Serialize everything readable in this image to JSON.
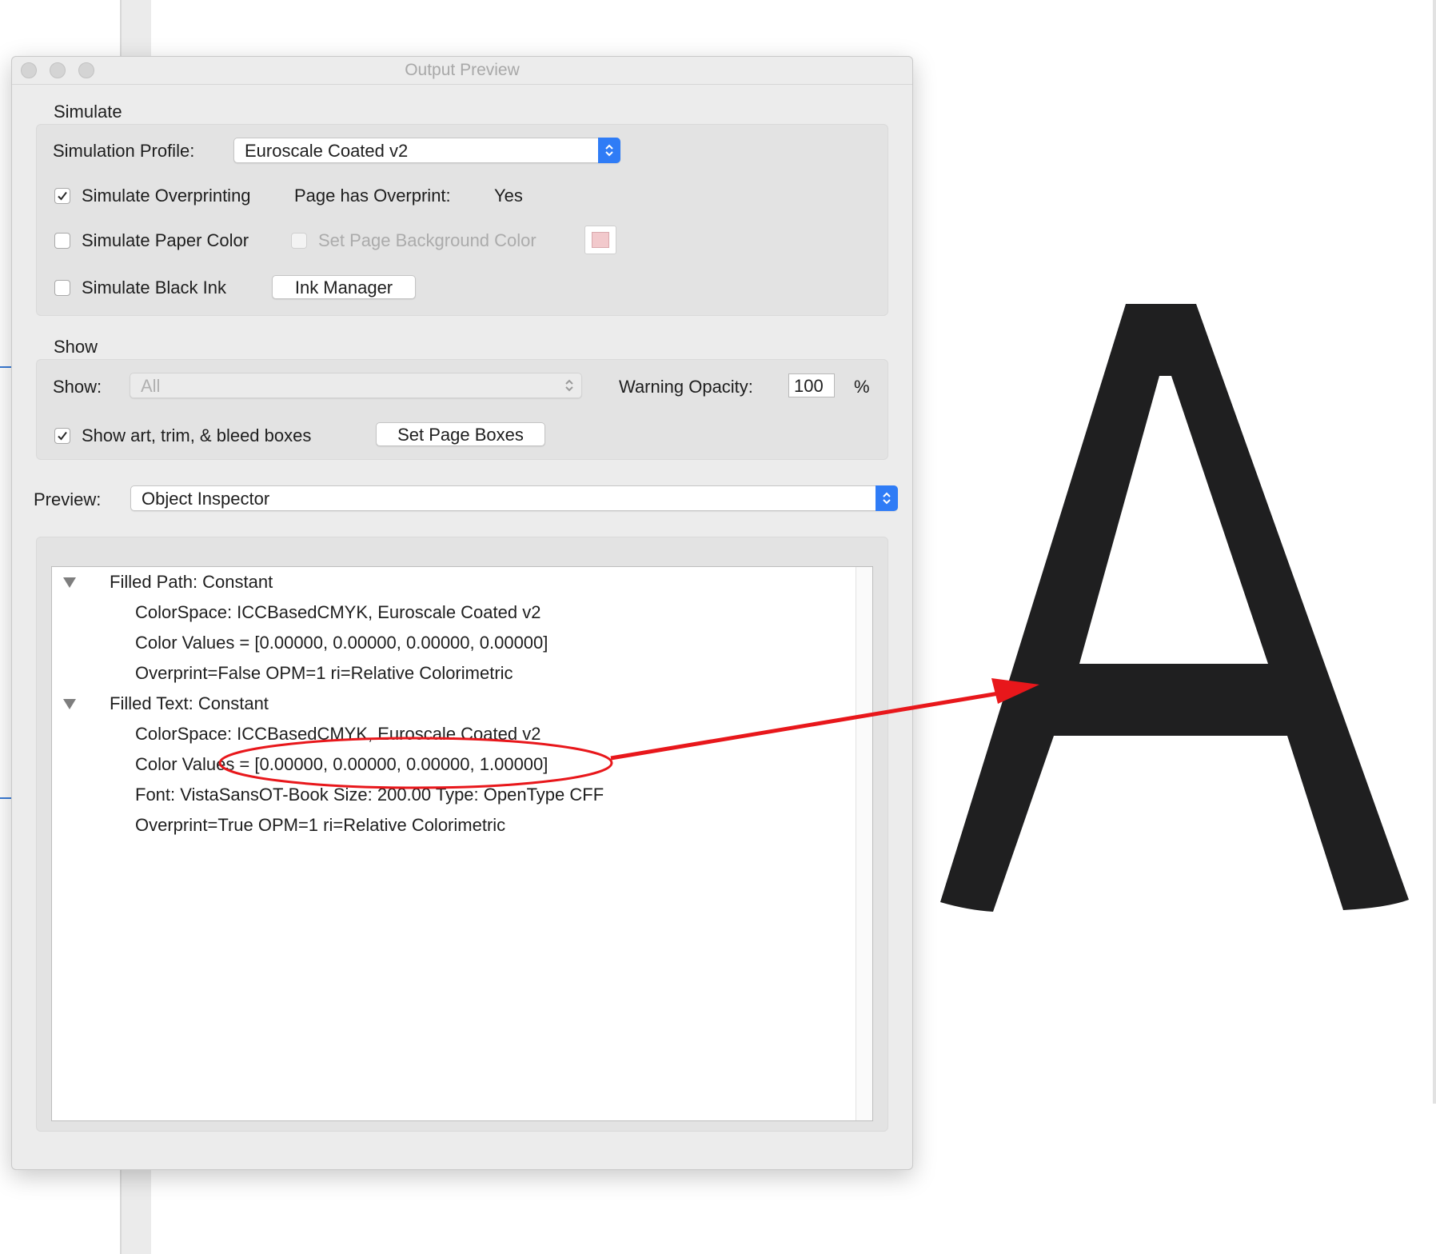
{
  "window": {
    "title": "Output Preview"
  },
  "simulate": {
    "heading": "Simulate",
    "profile_label": "Simulation Profile:",
    "profile_value": "Euroscale Coated v2",
    "overprinting_label": "Simulate Overprinting",
    "overprinting_checked": true,
    "page_has_overprint_label": "Page has Overprint:",
    "page_has_overprint_value": "Yes",
    "paper_color_label": "Simulate Paper Color",
    "paper_color_checked": false,
    "page_bg_label": "Set Page Background Color",
    "page_bg_enabled": false,
    "page_bg_swatch_color": "#f2c9cc",
    "black_ink_label": "Simulate Black Ink",
    "black_ink_checked": false,
    "ink_manager_label": "Ink Manager"
  },
  "show": {
    "heading": "Show",
    "show_label": "Show:",
    "show_value": "All",
    "warning_opacity_label": "Warning Opacity:",
    "warning_opacity_value": "100",
    "percent_label": "%",
    "boxes_label": "Show art, trim, & bleed boxes",
    "boxes_checked": true,
    "set_page_boxes_label": "Set Page Boxes"
  },
  "preview": {
    "label": "Preview:",
    "value": "Object Inspector"
  },
  "inspector": {
    "items": [
      {
        "title": "Filled Path: Constant",
        "details": [
          "ColorSpace: ICCBasedCMYK, Euroscale Coated v2",
          "Color Values = [0.00000, 0.00000, 0.00000, 0.00000]",
          "Overprint=False OPM=1 ri=Relative Colorimetric"
        ]
      },
      {
        "title": "Filled Text: Constant",
        "details": [
          "ColorSpace: ICCBasedCMYK, Euroscale Coated v2",
          "Color Values = [0.00000, 0.00000, 0.00000, 1.00000]",
          "Font: VistaSansOT-Book Size: 200.00 Type: OpenType CFF",
          "Overprint=True OPM=1 ri=Relative Colorimetric"
        ]
      }
    ]
  },
  "page": {
    "letter": "A",
    "letter_color": "#1f1f20"
  },
  "annotation": {
    "color": "#e8171b"
  },
  "colors": {
    "accent_blue": "#2f7cf6"
  }
}
